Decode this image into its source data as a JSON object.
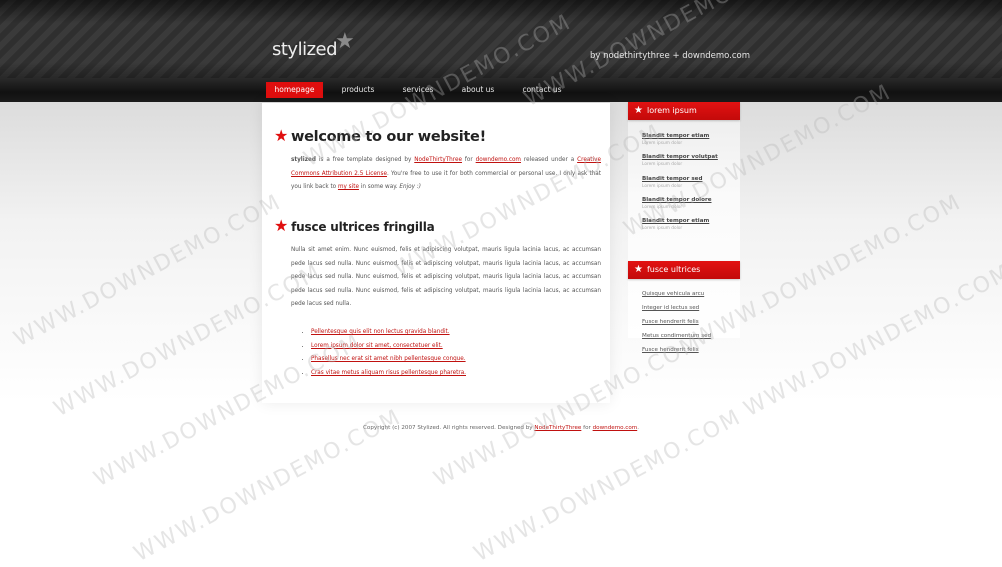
{
  "header": {
    "logo_text": "stylized",
    "logo_star": "★",
    "byline": "by nodethirtythree + downdemo.com"
  },
  "nav": {
    "items": [
      {
        "label": "homepage",
        "active": true
      },
      {
        "label": "products",
        "active": false
      },
      {
        "label": "services",
        "active": false
      },
      {
        "label": "about us",
        "active": false
      },
      {
        "label": "contact us",
        "active": false
      }
    ]
  },
  "main": {
    "title1": "welcome to our website!",
    "intro": {
      "brand": "stylized",
      "t1": " is a free template designed by ",
      "link_ntt": "NodeThirtyThree",
      "t2": " for ",
      "link_dd": "downdemo.com",
      "t3": " released under a ",
      "link_cc": "Creative Commons Attribution 2.5 License",
      "t4": ". You're free to use it for both commercial or personal use. I only ask that you link back to ",
      "link_site": "my site",
      "t5": " in some way. ",
      "enjoy": "Enjoy :)"
    },
    "title2": "fusce ultrices fringilla",
    "para2": "Nulla sit amet enim. Nunc euismod, felis et adipiscing volutpat, mauris ligula lacinia lacus, ac accumsan pede lacus sed nulla. Nunc euismod, felis et adipiscing volutpat, mauris ligula lacinia lacus, ac accumsan pede lacus sed nulla. Nunc euismod, felis et adipiscing volutpat, mauris ligula lacinia lacus, ac accumsan pede lacus sed nulla. Nunc euismod, felis et adipiscing volutpat, mauris ligula lacinia lacus, ac accumsan pede lacus sed nulla.",
    "list": [
      "Pellentesque quis elit non lectus gravida blandit.",
      "Lorem ipsum dolor sit amet, consectetuer elit.",
      "Phasellus nec erat sit amet nibh pellentesque congue.",
      "Cras vitae metus aliquam risus pellentesque pharetra."
    ]
  },
  "sidebar": {
    "head1": "lorem ipsum",
    "links1": [
      {
        "title": "Blandit tempor etiam",
        "sub": "Lorem ipsum dolor"
      },
      {
        "title": "Blandit tempor volutpat",
        "sub": "Lorem ipsum dolor"
      },
      {
        "title": "Blandit tempor sed",
        "sub": "Lorem ipsum dolor"
      },
      {
        "title": "Blandit tempor dolore",
        "sub": "Lorem ipsum dolor"
      },
      {
        "title": "Blandit tempor etiam",
        "sub": "Lorem ipsum dolor"
      }
    ],
    "head2": "fusce ultrices",
    "links2": [
      "Quisque vehicula arcu",
      "Integer id lectus sed",
      "Fusce hendrerit felis",
      "Metus condimentum sed",
      "Fusce hendrerit felis"
    ]
  },
  "footer": {
    "t1": "Copyright (c) 2007 Stylized. All rights reserved. Designed by ",
    "link_ntt": "NodeThirtyThree",
    "t2": " for ",
    "link_dd": "downdemo.com",
    "t3": "."
  },
  "watermark": "WWW.DOWNDEMO.COM",
  "colors": {
    "accent": "#e00e0e",
    "header": "#333333",
    "link": "#c0110f"
  }
}
